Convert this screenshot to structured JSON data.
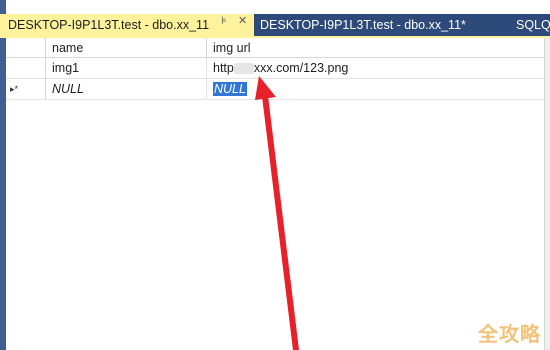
{
  "tabs": [
    {
      "label": "DESKTOP-I9P1L3T.test - dbo.xx_11",
      "active": true
    },
    {
      "label": "DESKTOP-I9P1L3T.test - dbo.xx_11*",
      "active": false
    },
    {
      "label": "SQLQ",
      "active": false
    }
  ],
  "tab_icons": {
    "pin": "pin-icon",
    "close": "close-icon"
  },
  "grid": {
    "columns": [
      "name",
      "img url"
    ],
    "rows": [
      {
        "selector": "",
        "name": "img1",
        "url_prefix": "http",
        "url_suffix": "xxx.com/123.png"
      },
      {
        "selector": "▸*",
        "name": "NULL",
        "url": "NULL"
      }
    ]
  },
  "watermark": "全攻略",
  "colors": {
    "tab_active": "#fff29d",
    "tab_bar": "#2d4a7b",
    "selection": "#3377d6",
    "arrow": "#e8202a"
  }
}
